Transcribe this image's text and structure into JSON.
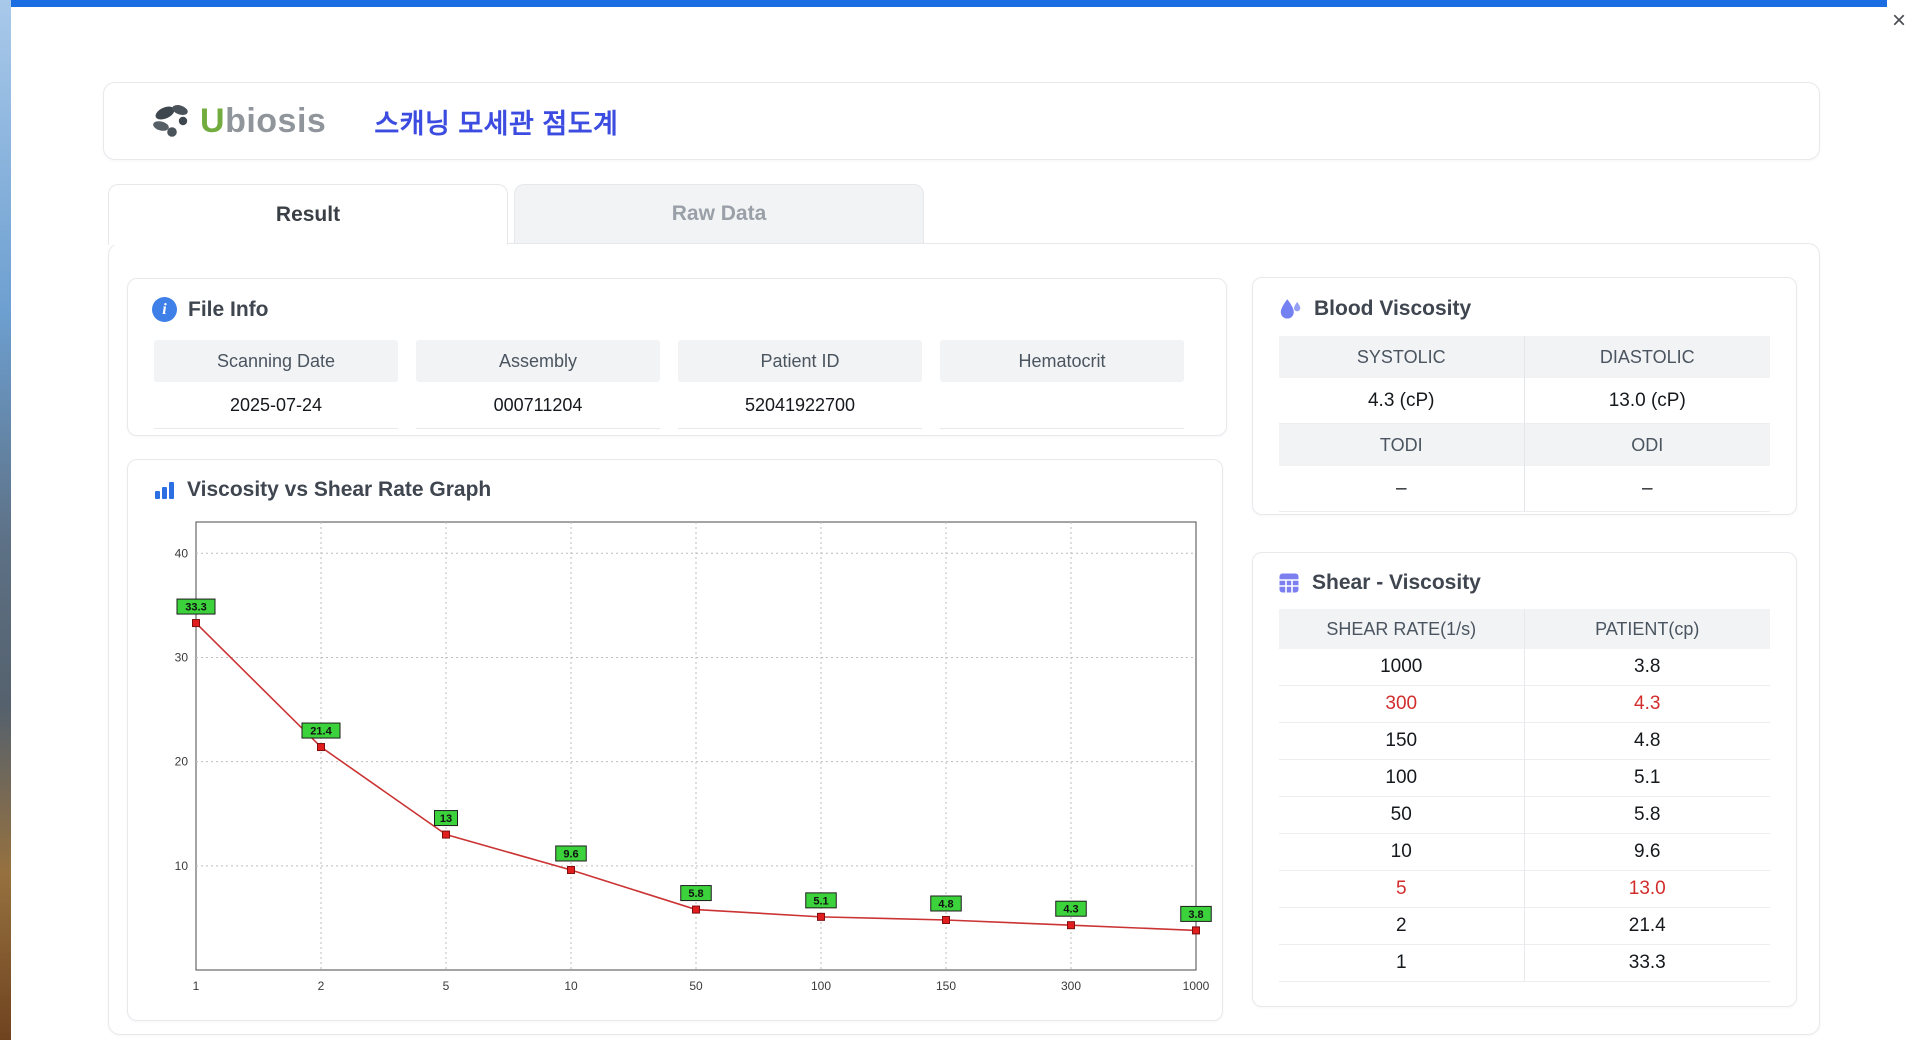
{
  "window": {
    "close_icon": "×"
  },
  "header": {
    "logo": {
      "brand_u": "U",
      "brand_rest": "biosis"
    },
    "title": "스캐닝 모세관 점도계"
  },
  "tabs": [
    {
      "label": "Result",
      "active": true
    },
    {
      "label": "Raw Data",
      "active": false
    }
  ],
  "file_info": {
    "title": "File Info",
    "fields": [
      {
        "label": "Scanning Date",
        "value": "2025-07-24"
      },
      {
        "label": "Assembly",
        "value": "000711204"
      },
      {
        "label": "Patient ID",
        "value": "52041922700"
      },
      {
        "label": "Hematocrit",
        "value": ""
      }
    ]
  },
  "graph": {
    "title": "Viscosity vs Shear Rate Graph"
  },
  "chart_data": {
    "type": "line",
    "title": "Viscosity vs Shear Rate Graph",
    "x_scale": "categorical",
    "x": [
      "1",
      "2",
      "5",
      "10",
      "50",
      "100",
      "150",
      "300",
      "1000"
    ],
    "series": [
      {
        "name": "PATIENT",
        "values": [
          33.3,
          21.4,
          13,
          9.6,
          5.8,
          5.1,
          4.8,
          4.3,
          3.8
        ]
      }
    ],
    "point_labels": [
      "33.3",
      "21.4",
      "13",
      "9.6",
      "5.8",
      "5.1",
      "4.8",
      "4.3",
      "3.8"
    ],
    "xlabel": "",
    "ylabel": "",
    "ylim": [
      0,
      43
    ],
    "yticks": [
      10,
      20,
      30,
      40
    ],
    "grid": true,
    "legend": false,
    "line_color": "#cb3434",
    "marker_color": "#e21d1d",
    "marker_stroke": "#7e0f0f",
    "label_bg": "#3bd23b",
    "label_border": "#1d1d1d"
  },
  "blood_viscosity": {
    "title": "Blood Viscosity",
    "cells": [
      {
        "label": "SYSTOLIC",
        "value": "4.3 (cP)"
      },
      {
        "label": "DIASTOLIC",
        "value": "13.0 (cP)"
      },
      {
        "label": "TODI",
        "value": "–"
      },
      {
        "label": "ODI",
        "value": "–"
      }
    ]
  },
  "shear_viscosity": {
    "title": "Shear - Viscosity",
    "columns": [
      "SHEAR RATE(1/s)",
      "PATIENT(cp)"
    ],
    "rows": [
      {
        "rate": "1000",
        "patient": "3.8",
        "highlight": false
      },
      {
        "rate": "300",
        "patient": "4.3",
        "highlight": true
      },
      {
        "rate": "150",
        "patient": "4.8",
        "highlight": false
      },
      {
        "rate": "100",
        "patient": "5.1",
        "highlight": false
      },
      {
        "rate": "50",
        "patient": "5.8",
        "highlight": false
      },
      {
        "rate": "10",
        "patient": "9.6",
        "highlight": false
      },
      {
        "rate": "5",
        "patient": "13.0",
        "highlight": true
      },
      {
        "rate": "2",
        "patient": "21.4",
        "highlight": false
      },
      {
        "rate": "1",
        "patient": "33.3",
        "highlight": false
      }
    ]
  }
}
